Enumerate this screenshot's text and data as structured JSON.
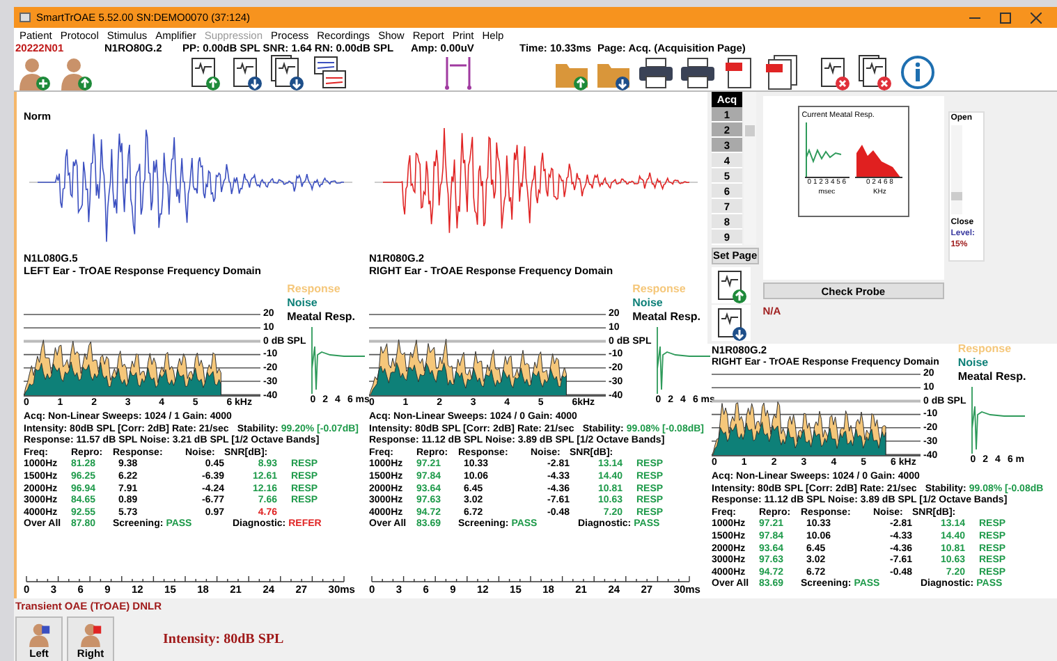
{
  "window": {
    "title": "SmartTrOAE 5.52.00   SN:DEMO0070 (37:124)"
  },
  "menu": [
    {
      "label": "Patient",
      "disabled": false
    },
    {
      "label": "Protocol",
      "disabled": false
    },
    {
      "label": "Stimulus",
      "disabled": false
    },
    {
      "label": "Amplifier",
      "disabled": false
    },
    {
      "label": "Suppression",
      "disabled": true
    },
    {
      "label": "Process",
      "disabled": false
    },
    {
      "label": "Recordings",
      "disabled": false
    },
    {
      "label": "Show",
      "disabled": false
    },
    {
      "label": "Report",
      "disabled": false
    },
    {
      "label": "Print",
      "disabled": false
    },
    {
      "label": "Help",
      "disabled": false
    }
  ],
  "info_bar": {
    "patient_id": "20222N01",
    "recording": "N1RO80G.2",
    "levels": "PP: 0.00dB SPL SNR: 1.64 RN: 0.00dB SPL",
    "amp": "Amp:  0.00uV",
    "time": "Time: 10.33ms",
    "page": "Page: Acq. (Acquisition Page)"
  },
  "toolbar": [
    {
      "kind": "person-add"
    },
    {
      "kind": "person-up"
    },
    {
      "kind": "sep"
    },
    {
      "kind": "wave-up"
    },
    {
      "kind": "wave-down"
    },
    {
      "kind": "waves-down"
    },
    {
      "kind": "compare"
    },
    {
      "kind": "sep"
    },
    {
      "kind": "cursors"
    },
    {
      "kind": "sep"
    },
    {
      "kind": "folder-up"
    },
    {
      "kind": "folder-down"
    },
    {
      "kind": "printer"
    },
    {
      "kind": "printer"
    },
    {
      "kind": "pdf"
    },
    {
      "kind": "pdfs"
    },
    {
      "kind": "sep"
    },
    {
      "kind": "wave-delete"
    },
    {
      "kind": "waves-delete"
    },
    {
      "kind": "info"
    }
  ],
  "ears": [
    {
      "color": "#3b4fc0",
      "wave_label": "Norm",
      "id_label": "N1L080G.5",
      "title": "LEFT Ear - TrOAE Response Frequency Domain",
      "chart": {
        "legend": [
          {
            "label": "Response",
            "color": "#f5c77a"
          },
          {
            "label": "Noise",
            "color": "#0e8078"
          },
          {
            "label": "Meatal Resp.",
            "color": "#000000"
          }
        ],
        "y_ticks": [
          "20",
          "10",
          "0 dB SPL",
          "-10",
          "-20",
          "-30",
          "-40"
        ],
        "x_ticks": [
          "0",
          "1",
          "2",
          "3",
          "4",
          "5",
          "6 kHz"
        ],
        "meatal_ticks": [
          "0",
          "2",
          "4",
          "6 ms"
        ]
      },
      "acq": "Acq: Non-Linear   Sweeps: 1024 / 1   Gain: 4000",
      "intensity": "Intensity: 80dB SPL  [Corr: 2dB]  Rate: 21/sec",
      "stability_label": "Stability:",
      "stability": "99.20% [-0.07dB]",
      "response": "Response: 11.57 dB SPL Noise:  3.21 dB SPL   [1/2 Octave Bands]",
      "columns": [
        "Freq:",
        "Repro:",
        "Response:",
        "Noise:",
        "SNR[dB]:"
      ],
      "rows": [
        {
          "freq": "1000Hz",
          "repro": "81.28",
          "response": "9.38",
          "noise": "0.45",
          "snr": "8.93",
          "pass": true,
          "result": "RESP"
        },
        {
          "freq": "1500Hz",
          "repro": "96.25",
          "response": "6.22",
          "noise": "-6.39",
          "snr": "12.61",
          "pass": true,
          "result": "RESP"
        },
        {
          "freq": "2000Hz",
          "repro": "96.94",
          "response": "7.91",
          "noise": "-4.24",
          "snr": "12.16",
          "pass": true,
          "result": "RESP"
        },
        {
          "freq": "3000Hz",
          "repro": "84.65",
          "response": "0.89",
          "noise": "-6.77",
          "snr": "7.66",
          "pass": true,
          "result": "RESP"
        },
        {
          "freq": "4000Hz",
          "repro": "92.55",
          "response": "5.73",
          "noise": "0.97",
          "snr": "4.76",
          "pass": false
        }
      ],
      "overall": {
        "label": "Over All",
        "value": "87.80",
        "screening_label": "Screening:",
        "screening": "PASS",
        "screening_pass": true,
        "diagnostic_label": "Diagnostic:",
        "diagnostic": "REFER",
        "diagnostic_pass": false
      },
      "time_ticks": [
        "0",
        "3",
        "6",
        "9",
        "12",
        "15",
        "18",
        "21",
        "24",
        "27",
        "30ms"
      ]
    },
    {
      "color": "#e02424",
      "id_label": "N1R080G.2",
      "title": "RIGHT Ear - TrOAE Response Frequency Domain",
      "chart": {
        "legend": [
          {
            "label": "Response",
            "color": "#f5c77a"
          },
          {
            "label": "Noise",
            "color": "#0e8078"
          },
          {
            "label": "Meatal Resp.",
            "color": "#000000"
          }
        ],
        "y_ticks": [
          "20",
          "10",
          "0 dB SPL",
          "-10",
          "-20",
          "-30",
          "-40"
        ],
        "x_ticks": [
          "0",
          "1",
          "2",
          "3",
          "4",
          "5",
          "6kHz"
        ],
        "meatal_ticks": [
          "0",
          "2",
          "4",
          "6 ms"
        ]
      },
      "acq": "Acq: Non-Linear   Sweeps: 1024 / 0   Gain: 4000",
      "intensity": "Intensity: 80dB SPL  [Corr: 2dB]  Rate: 21/sec",
      "stability_label": "Stability:",
      "stability": "99.08% [-0.08dB]",
      "response": "Response: 11.12 dB SPL Noise:  3.89 dB SPL   [1/2 Octave Bands]",
      "columns": [
        "Freq:",
        "Repro:",
        "Response:",
        "Noise:",
        "SNR[dB]:"
      ],
      "rows": [
        {
          "freq": "1000Hz",
          "repro": "97.21",
          "response": "10.33",
          "noise": "-2.81",
          "snr": "13.14",
          "pass": true,
          "result": "RESP"
        },
        {
          "freq": "1500Hz",
          "repro": "97.84",
          "response": "10.06",
          "noise": "-4.33",
          "snr": "14.40",
          "pass": true,
          "result": "RESP"
        },
        {
          "freq": "2000Hz",
          "repro": "93.64",
          "response": "6.45",
          "noise": "-4.36",
          "snr": "10.81",
          "pass": true,
          "result": "RESP"
        },
        {
          "freq": "3000Hz",
          "repro": "97.63",
          "response": "3.02",
          "noise": "-7.61",
          "snr": "10.63",
          "pass": true,
          "result": "RESP"
        },
        {
          "freq": "4000Hz",
          "repro": "94.72",
          "response": "6.72",
          "noise": "-0.48",
          "snr": "7.20",
          "pass": true,
          "result": "RESP"
        }
      ],
      "overall": {
        "label": "Over All",
        "value": "83.69",
        "screening_label": "Screening:",
        "screening": "PASS",
        "screening_pass": true,
        "diagnostic_label": "Diagnostic:",
        "diagnostic": "PASS",
        "diagnostic_pass": true
      },
      "time_ticks": [
        "0",
        "3",
        "6",
        "9",
        "12",
        "15",
        "18",
        "21",
        "24",
        "27",
        "30ms"
      ]
    }
  ],
  "acq_list": {
    "header": "Acq",
    "items": [
      {
        "label": "1",
        "recorded": true
      },
      {
        "label": "2",
        "recorded": true
      },
      {
        "label": "3",
        "recorded": true
      },
      {
        "label": "4",
        "recorded": false
      },
      {
        "label": "5",
        "recorded": false
      },
      {
        "label": "6",
        "recorded": false
      },
      {
        "label": "7",
        "recorded": false
      },
      {
        "label": "8",
        "recorded": false
      },
      {
        "label": "9",
        "recorded": false
      }
    ],
    "set_page": "Set Page"
  },
  "probe": {
    "title": "Current Meatal Resp.",
    "time_ticks": "0 1 2 3 4 5 6",
    "freq_ticks": "0 2 4 6 8",
    "time_unit": "msec",
    "freq_unit": "KHz",
    "open": "Open",
    "close": "Close",
    "level_label": "Level:",
    "level_value": "15%",
    "check_button": "Check Probe",
    "status": "N/A"
  },
  "summary": {
    "id_label": "N1R080G.2",
    "title": "RIGHT Ear - TrOAE Response Frequency Domain",
    "chart": {
      "legend": [
        {
          "label": "Response",
          "color": "#f5c77a"
        },
        {
          "label": "Noise",
          "color": "#0e8078"
        },
        {
          "label": "Meatal Resp.",
          "color": "#000000"
        }
      ],
      "y_ticks": [
        "20",
        "10",
        "0 dB SPL",
        "-10",
        "-20",
        "-30",
        "-40"
      ],
      "x_ticks": [
        "0",
        "1",
        "2",
        "3",
        "4",
        "5",
        "6 kHz"
      ],
      "meatal_ticks": [
        "0",
        "2",
        "4",
        "6 m"
      ]
    },
    "acq": "Acq: Non-Linear   Sweeps: 1024 / 0   Gain: 4000",
    "intensity": "Intensity: 80dB SPL  [Corr: 2dB]  Rate: 21/sec",
    "stability_label": "Stability:",
    "stability": "99.08% [-0.08dB",
    "response": "Response: 11.12 dB SPL Noise:  3.89 dB SPL   [1/2 Octave Bands]",
    "columns": [
      "Freq:",
      "Repro:",
      "Response:",
      "Noise:",
      "SNR[dB]:"
    ],
    "rows": [
      {
        "freq": "1000Hz",
        "repro": "97.21",
        "response": "10.33",
        "noise": "-2.81",
        "snr": "13.14",
        "pass": true,
        "result": "RESP"
      },
      {
        "freq": "1500Hz",
        "repro": "97.84",
        "response": "10.06",
        "noise": "-4.33",
        "snr": "14.40",
        "pass": true,
        "result": "RESP"
      },
      {
        "freq": "2000Hz",
        "repro": "93.64",
        "response": "6.45",
        "noise": "-4.36",
        "snr": "10.81",
        "pass": true,
        "result": "RESP"
      },
      {
        "freq": "3000Hz",
        "repro": "97.63",
        "response": "3.02",
        "noise": "-7.61",
        "snr": "10.63",
        "pass": true,
        "result": "RESP"
      },
      {
        "freq": "4000Hz",
        "repro": "94.72",
        "response": "6.72",
        "noise": "-0.48",
        "snr": "7.20",
        "pass": true,
        "result": "RESP"
      }
    ],
    "overall": {
      "label": "Over All",
      "value": "83.69",
      "screening_label": "Screening:",
      "screening": "PASS",
      "screening_pass": true,
      "diagnostic_label": "Diagnostic:",
      "diagnostic": "PASS",
      "diagnostic_pass": true
    }
  },
  "footer": {
    "mode": "Transient OAE (TrOAE) DNLR",
    "ear_buttons": [
      "Left",
      "Right"
    ],
    "intensity": "Intensity: 80dB SPL"
  }
}
